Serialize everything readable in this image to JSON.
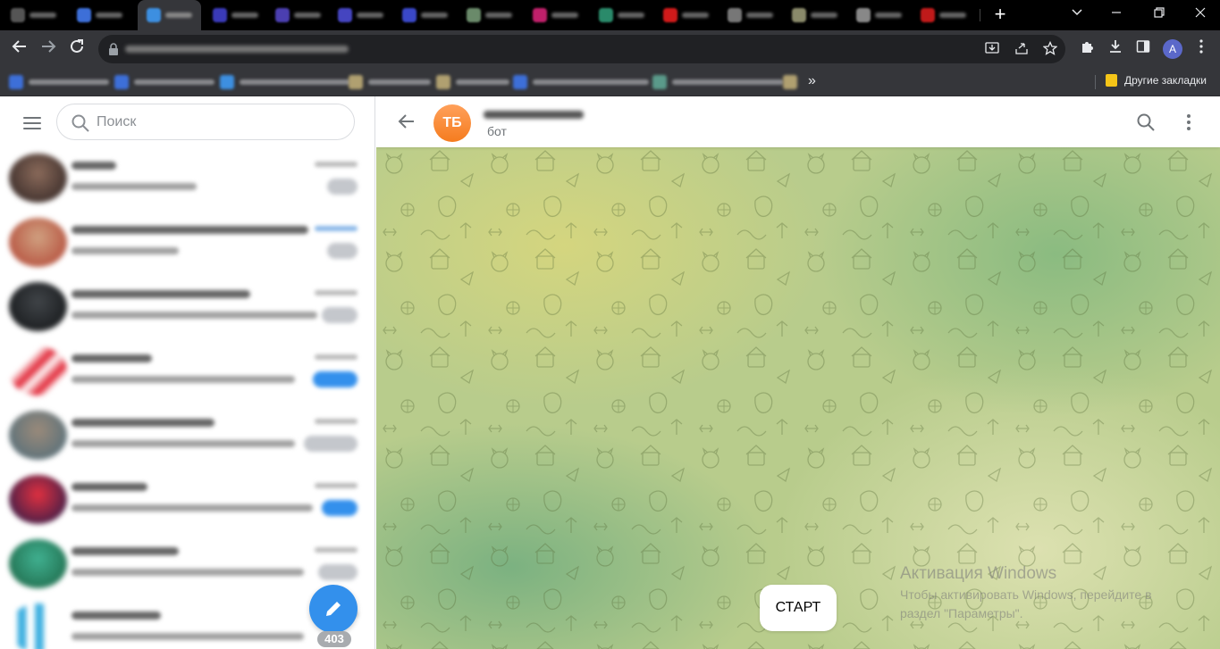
{
  "browser": {
    "tabs_count": 14,
    "active_tab_index": 2,
    "new_tab_label": "+",
    "window_controls": [
      "chevron-down-icon",
      "minimize-icon",
      "restore-icon",
      "close-icon"
    ],
    "toolbar_icons": [
      "back-arrow-icon",
      "forward-arrow-icon",
      "reload-icon",
      "lock-icon",
      "install-app-icon",
      "share-icon",
      "star-icon",
      "extensions-icon",
      "download-icon",
      "side-panel-icon",
      "more-vert-icon"
    ],
    "profile_initial": "A",
    "profile_color": "#5b68c9",
    "bookmarks_bar": {
      "overflow_label": "»",
      "other_bookmarks_label": "Другие закладки"
    }
  },
  "telegram": {
    "sidebar": {
      "menu_icon": "hamburger-menu-icon",
      "search_placeholder": "Поиск",
      "chats_count": 8,
      "compose_icon": "pencil-icon",
      "compose_badge": "403"
    },
    "chat": {
      "peer_initials": "ТБ",
      "peer_status": "бот",
      "peer_avatar_color": "#f57c1f",
      "header_icons": [
        "back-arrow-icon",
        "search-icon",
        "more-vert-icon"
      ],
      "start_button_label": "СТАРТ"
    },
    "watermark": {
      "title": "Активация Windows",
      "subtitle": "Чтобы активировать Windows, перейдите в раздел \"Параметры\"."
    },
    "accent_color": "#3390ec"
  }
}
